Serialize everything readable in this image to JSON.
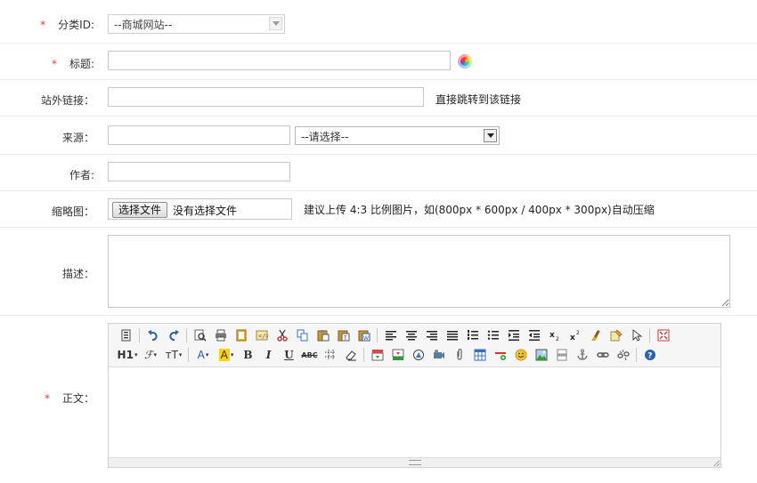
{
  "form": {
    "category": {
      "label": "分类ID:",
      "required_mark": "*",
      "selected": "--商城网站--"
    },
    "title": {
      "label": "标题:",
      "required_mark": "*",
      "value": "",
      "color_icon": "color-picker-icon"
    },
    "external_link": {
      "label": "站外链接：",
      "value": "",
      "hint": "直接跳转到该链接"
    },
    "source": {
      "label": "来源：",
      "value": "",
      "select_selected": "--请选择--"
    },
    "author": {
      "label": "作者:",
      "value": ""
    },
    "thumbnail": {
      "label": "缩略图：",
      "button_label": "选择文件",
      "file_status": "没有选择文件",
      "hint": "建议上传 4:3 比例图片，如(800px * 600px / 400px * 300px)自动压缩"
    },
    "description": {
      "label": "描述：",
      "value": ""
    },
    "content": {
      "label": "正文：",
      "required_mark": "*",
      "toolbar_row1": [
        "source-icon",
        "undo-icon",
        "redo-icon",
        "preview-icon",
        "print-icon",
        "template-icon",
        "code-icon",
        "cut-icon",
        "copy-icon",
        "paste-icon",
        "paste-plain-icon",
        "paste-word-icon",
        "align-left-icon",
        "align-center-icon",
        "align-right-icon",
        "justify-icon",
        "ordered-list-icon",
        "unordered-list-icon",
        "indent-icon",
        "outdent-icon",
        "subscript-icon",
        "superscript-icon",
        "clear-format-icon",
        "select-all-icon",
        "pointer-icon",
        "fullscreen-icon"
      ],
      "toolbar_row2_text": {
        "heading": "H1",
        "font": "ℱ",
        "fontsize": "тT",
        "forecolor": "A",
        "hilitecolor": "A",
        "bold": "B",
        "italic": "I",
        "underline": "U",
        "strike": "ABC"
      }
    }
  },
  "colors": {
    "required": "#e0393e",
    "border": "#c9c9c9",
    "toolbar_bg": "#f6f6f6"
  }
}
